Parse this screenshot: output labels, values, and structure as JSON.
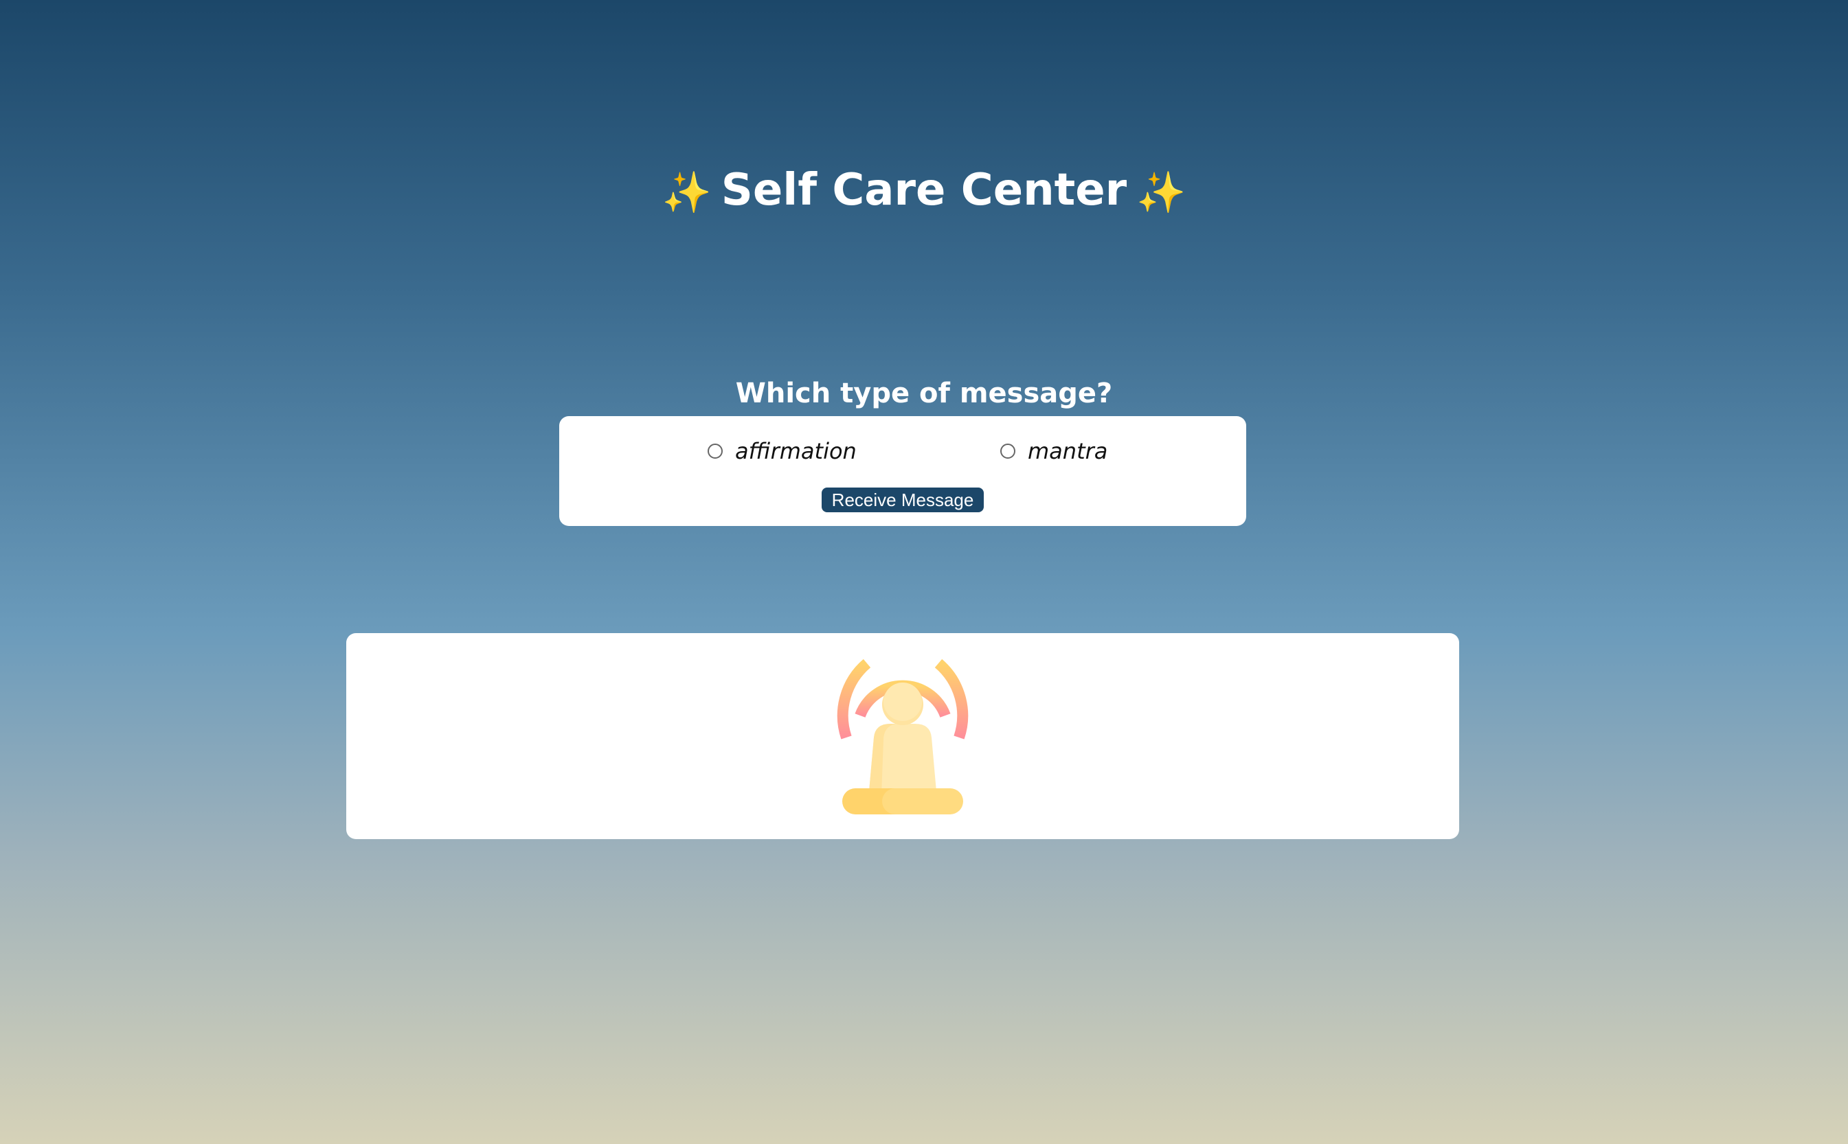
{
  "header": {
    "title": "Self Care Center",
    "sparkle_icon": "sparkles-icon"
  },
  "form": {
    "question": "Which type of message?",
    "options": [
      {
        "label": "affirmation",
        "selected": false
      },
      {
        "label": "mantra",
        "selected": false
      }
    ],
    "button_label": "Receive Message"
  },
  "message": {
    "icon": "meditation-icon"
  },
  "colors": {
    "accent": "#1c4769",
    "sparkle": "#f4c542",
    "card": "#ffffff"
  }
}
